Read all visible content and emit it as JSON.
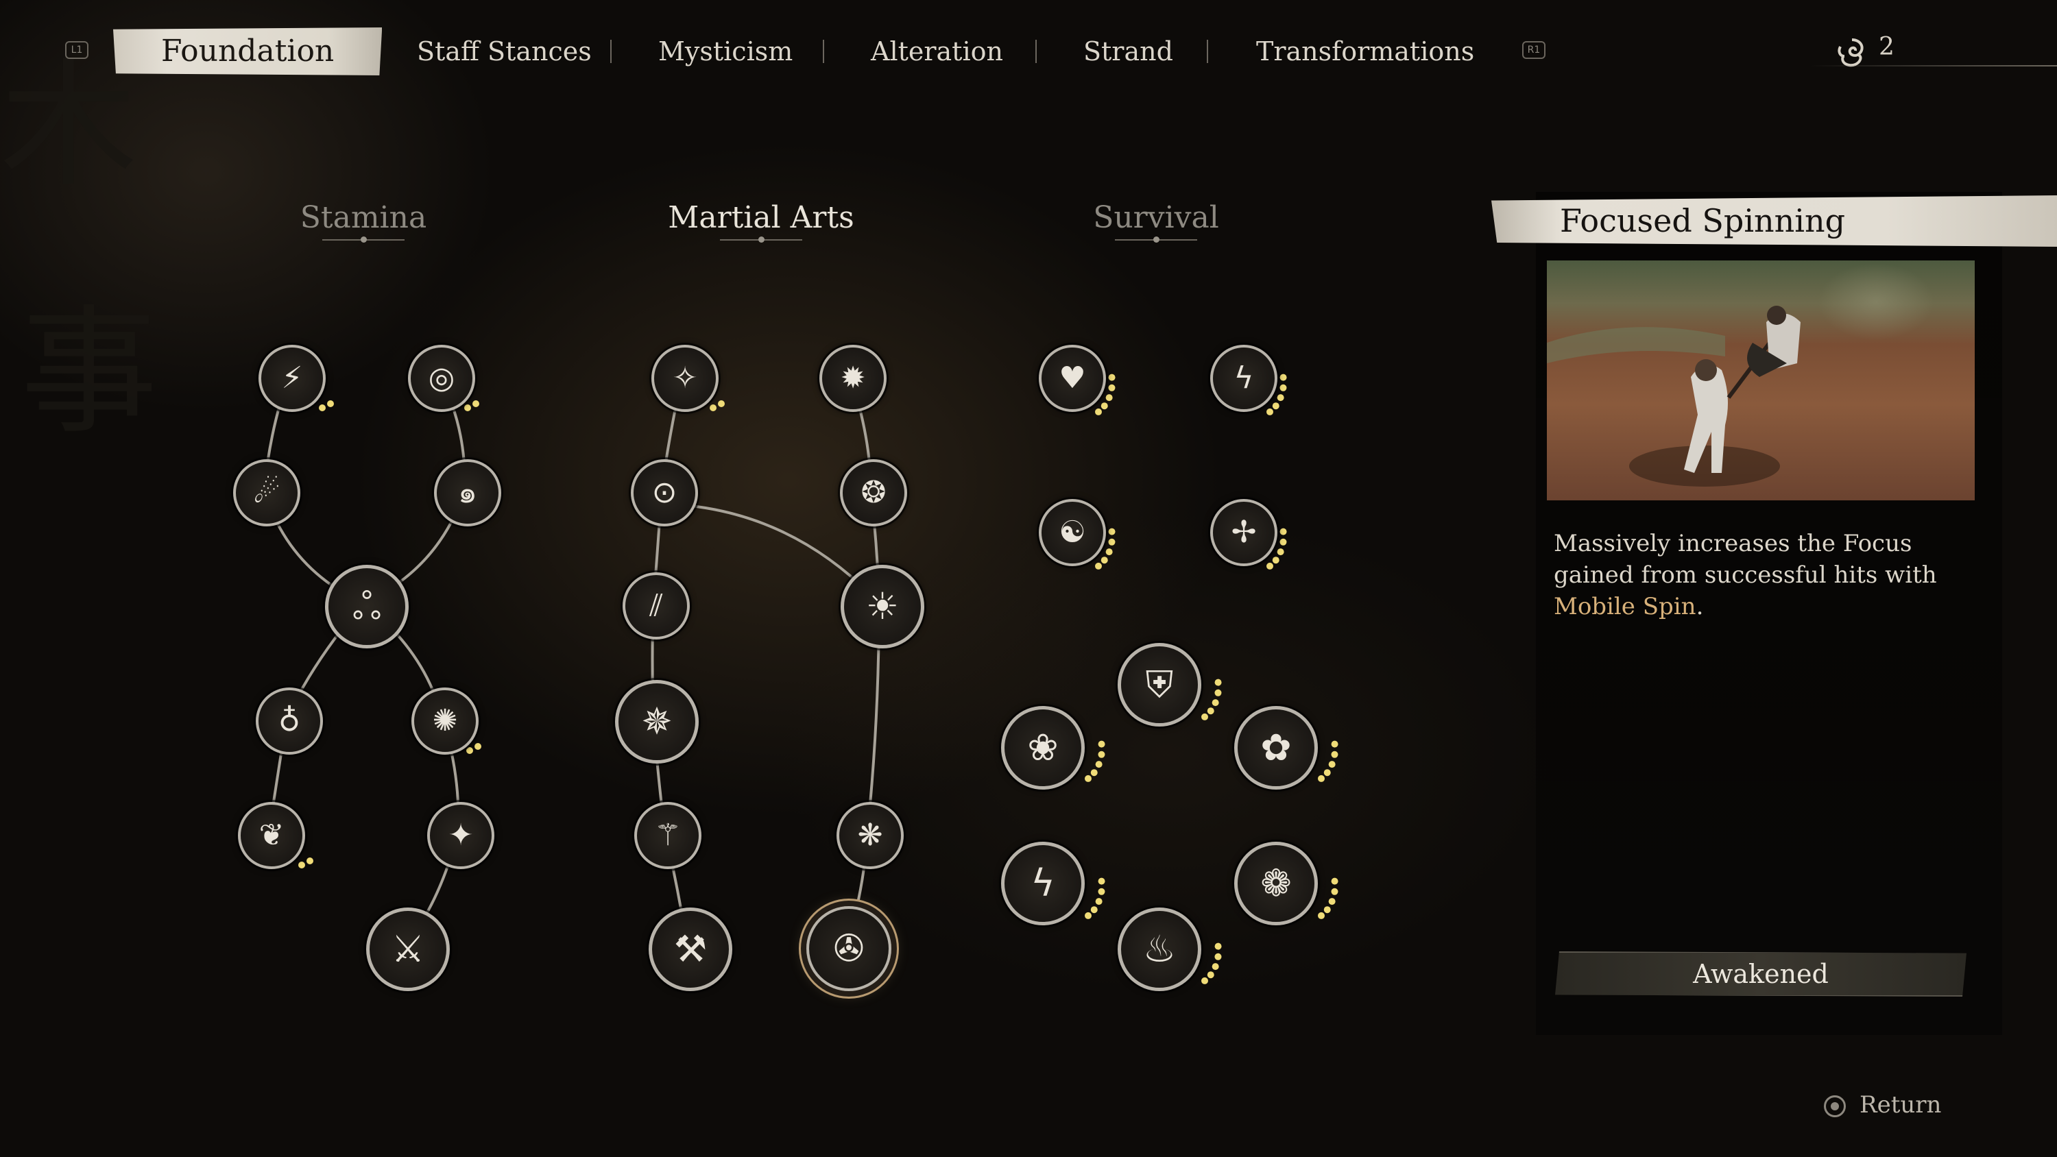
{
  "tabs": {
    "left_hint": "L1",
    "right_hint": "R1",
    "items": [
      "Foundation",
      "Staff Stances",
      "Mysticism",
      "Alteration",
      "Strand",
      "Transformations"
    ]
  },
  "currency": {
    "icon": "spirit-swirl-icon",
    "count": "2"
  },
  "columns": {
    "stamina": "Stamina",
    "martial_arts": "Martial Arts",
    "survival": "Survival"
  },
  "details": {
    "title": "Focused Spinning",
    "desc_a": "Massively increases the Focus gained from successful hits with ",
    "desc_highlight": "Mobile Spin",
    "desc_b": ".",
    "status": "Awakened"
  },
  "footer": {
    "return_label": "Return",
    "return_icon": "circle-button-icon"
  },
  "colors": {
    "highlight": "#d8b17a",
    "node_ring": "#b8b3aa",
    "pip": "#f0dc78"
  }
}
